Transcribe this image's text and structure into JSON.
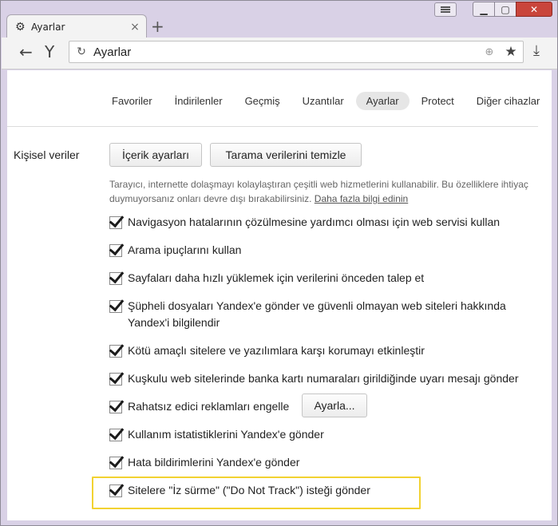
{
  "tab": {
    "title": "Ayarlar",
    "close": "×",
    "new_tab": "+"
  },
  "window_controls": {
    "min": "▁",
    "max": "▢",
    "close": "✕"
  },
  "toolbar": {
    "url": "Ayarlar",
    "back": "←",
    "logo": "Y",
    "reload": "↻",
    "star": "★",
    "download": "⤓",
    "globe": "⊕"
  },
  "nav": {
    "items": [
      "Favoriler",
      "İndirilenler",
      "Geçmiş",
      "Uzantılar",
      "Ayarlar",
      "Protect",
      "Diğer cihazlar"
    ],
    "active": "Ayarlar"
  },
  "privacy": {
    "section_label": "Kişisel veriler",
    "content_settings_button": "İçerik ayarları",
    "clear_data_button": "Tarama verilerini temizle",
    "description": "Tarayıcı, internette dolaşmayı kolaylaştıran çeşitli web hizmetlerini kullanabilir. Bu özelliklere ihtiyaç duymuyorsanız onları devre dışı bırakabilirsiniz.",
    "learn_more": "Daha fazla bilgi edinin",
    "options": [
      {
        "label": "Navigasyon hatalarının çözülmesine yardımcı olması için web servisi kullan",
        "checked": true
      },
      {
        "label": "Arama ipuçlarını kullan",
        "checked": true
      },
      {
        "label": "Sayfaları daha hızlı yüklemek için verilerini önceden talep et",
        "checked": true
      },
      {
        "label": "Şüpheli dosyaları Yandex'e gönder ve güvenli olmayan web siteleri hakkında Yandex'i bilgilendir",
        "checked": true
      },
      {
        "label": "Kötü amaçlı sitelere ve yazılımlara karşı korumayı etkinleştir",
        "checked": true
      },
      {
        "label": "Kuşkulu web sitelerinde banka kartı numaraları girildiğinde uyarı mesajı gönder",
        "checked": true
      },
      {
        "label": "Rahatsız edici reklamları engelle",
        "checked": true
      },
      {
        "label": "Kullanım istatistiklerini Yandex'e gönder",
        "checked": true
      },
      {
        "label": "Hata bildirimlerini Yandex'e gönder",
        "checked": true
      },
      {
        "label": "Sitelere \"İz sürme\" (\"Do Not Track\") isteği gönder",
        "checked": true
      }
    ],
    "configure_button": "Ayarla..."
  },
  "colors": {
    "highlight": "#f2d231",
    "window_frame": "#d9d1e6",
    "close_button": "#c9453b"
  }
}
